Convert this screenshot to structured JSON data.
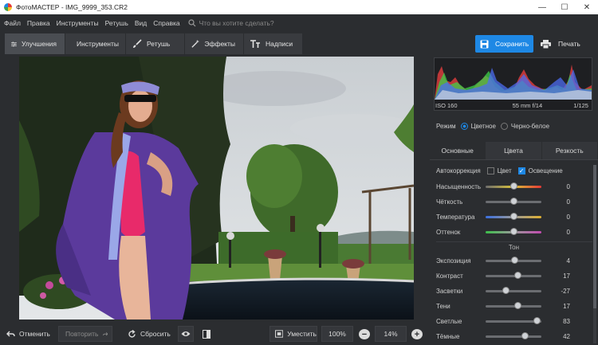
{
  "window": {
    "title": "ФотоМАСТЕР - IMG_9999_353.CR2",
    "min": "—",
    "max": "☐",
    "close": "✕"
  },
  "menu": {
    "items": [
      "Файл",
      "Правка",
      "Инструменты",
      "Ретушь",
      "Вид",
      "Справка"
    ],
    "search_placeholder": "Что вы хотите сделать?"
  },
  "toolbar": {
    "tabs": [
      {
        "label": "Улучшения",
        "icon": "sliders-icon"
      },
      {
        "label": "Инструменты",
        "icon": "crop-icon"
      },
      {
        "label": "Ретушь",
        "icon": "brush-icon"
      },
      {
        "label": "Эффекты",
        "icon": "magic-wand-icon"
      },
      {
        "label": "Надписи",
        "icon": "text-icon"
      }
    ],
    "save_label": "Сохранить",
    "print_label": "Печать"
  },
  "bottom": {
    "undo": "Отменить",
    "redo": "Повторить",
    "reset": "Сбросить",
    "fit": "Уместить",
    "zoom100": "100%",
    "zoom_level": "14%",
    "zoom_out": "−",
    "zoom_in": "+"
  },
  "histogram": {
    "iso": "ISO 160",
    "lens": "55 mm f/14",
    "shutter": "1/125"
  },
  "mode": {
    "label": "Режим",
    "color": "Цветное",
    "bw": "Черно-белое",
    "selected": "Цветное"
  },
  "subtabs": [
    "Основные",
    "Цвета",
    "Резкость"
  ],
  "auto": {
    "label": "Автокоррекция",
    "color": "Цвет",
    "light": "Освещение",
    "color_checked": false,
    "light_checked": true
  },
  "tone_header": "Тон",
  "sliders": [
    {
      "label": "Насыщенность",
      "value": "0",
      "level": 0.5
    },
    {
      "label": "Чёткость",
      "value": "0",
      "level": 0.5
    },
    {
      "label": "Температура",
      "value": "0",
      "level": 0.5
    },
    {
      "label": "Оттенок",
      "value": "0",
      "level": 0.5
    },
    {
      "label": "Экспозиция",
      "value": "4",
      "level": 0.52
    },
    {
      "label": "Контраст",
      "value": "17",
      "level": 0.585
    },
    {
      "label": "Засветки",
      "value": "-27",
      "level": 0.365
    },
    {
      "label": "Тени",
      "value": "17",
      "level": 0.585
    },
    {
      "label": "Светлые",
      "value": "83",
      "level": 0.915
    },
    {
      "label": "Тёмные",
      "value": "42",
      "level": 0.71
    }
  ],
  "colors": {
    "accent": "#1e88e5",
    "bg": "#2b2d30"
  }
}
